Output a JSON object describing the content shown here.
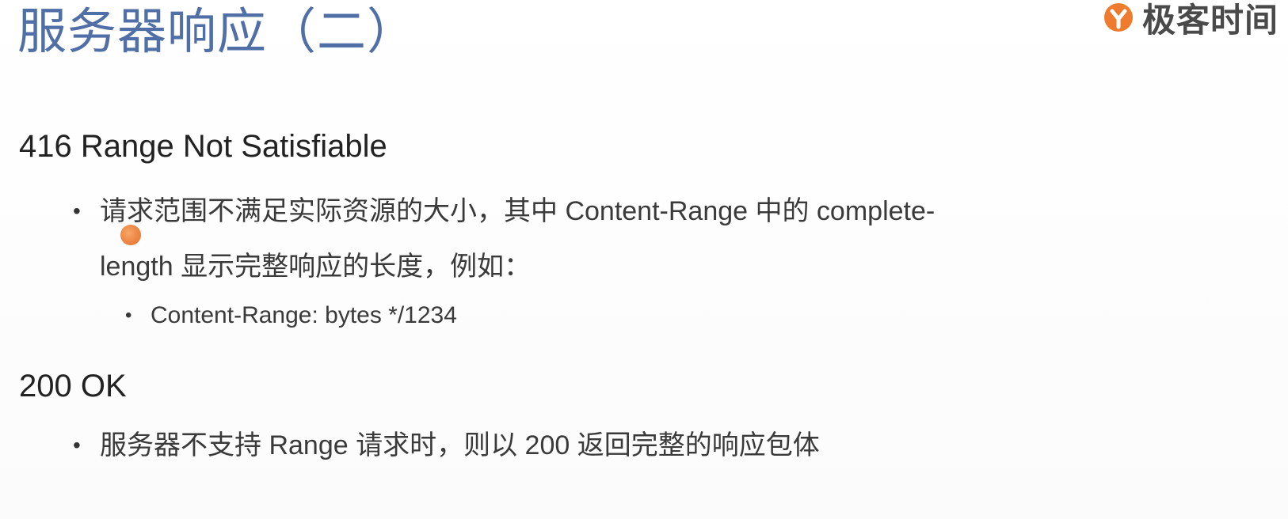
{
  "title": "服务器响应（二）",
  "brand": {
    "name": "极客时间",
    "accent": "#ee7b2e",
    "icon": "geektime-logo-icon"
  },
  "sections": [
    {
      "heading": "416 Range Not Satisfiable",
      "bullets": [
        {
          "line1": "请求范围不满足实际资源的大小，其中 Content-Range 中的 complete-",
          "line2": "length 显示完整响应的长度，例如：",
          "sub_bullets": [
            "Content-Range: bytes */1234"
          ]
        }
      ]
    },
    {
      "heading": "200 OK",
      "bullets": [
        {
          "text": "服务器不支持 Range 请求时，则以 200 返回完整的响应包体"
        }
      ]
    }
  ],
  "bullet_glyph": "•",
  "colors": {
    "title": "#4f6fa6",
    "text": "#333333",
    "cursor": "#ee7b2e"
  }
}
